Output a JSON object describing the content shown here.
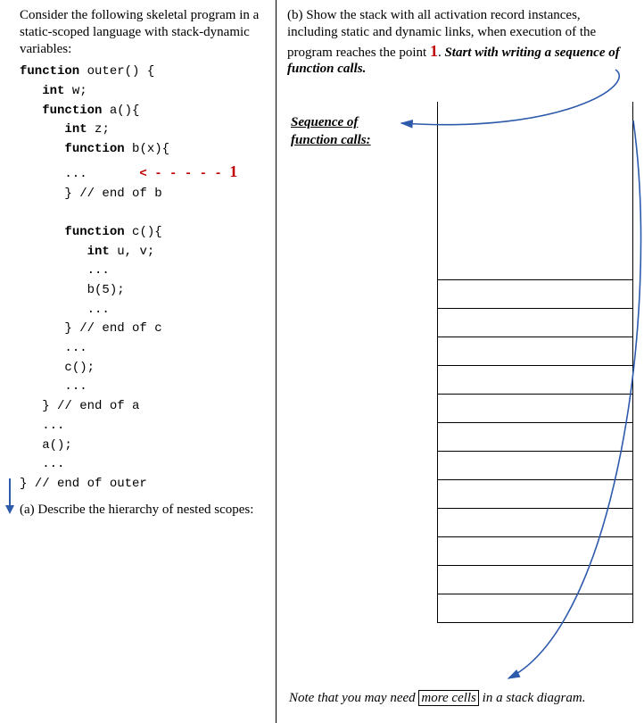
{
  "left": {
    "intro": "Consider the following skeletal program in a static-scoped language with stack-dynamic variables:",
    "code": {
      "l1a": "function",
      "l1b": " outer() {",
      "l2a": "int",
      "l2b": " w;",
      "l3a": "function",
      "l3b": " a(){",
      "l4a": "int",
      "l4b": " z;",
      "l5a": "function",
      "l5b": " b(x){",
      "l6_pre": "      ...       ",
      "l6_arrow": "< - - - - - ",
      "l6_mark": "1",
      "l7": "} // end of b",
      "l8a": "function",
      "l8b": " c(){",
      "l9a": "int",
      "l9b": " u, v;",
      "l10": "...",
      "l11": "b(5);",
      "l12": "...",
      "l13": "} // end of c",
      "l14": "...",
      "l15": "c();",
      "l16": "...",
      "l17": "} // end of a",
      "l18": "...",
      "l19": "a();",
      "l20": "...",
      "l21": "} // end of outer"
    },
    "questionA": "(a) Describe the hierarchy of nested scopes:"
  },
  "right": {
    "intro_a": "(b) Show the stack with all activation record instances, including static and dynamic links, when execution of the program reaches the point ",
    "intro_mark": "1",
    "intro_b": ". ",
    "intro_c": "Start with writing a sequence of function calls.",
    "seq_label_1": "Sequence  of",
    "seq_label_2": "function  calls:",
    "note_a": "Note that you may need ",
    "note_box": "more cells",
    "note_b": " in a stack diagram."
  }
}
